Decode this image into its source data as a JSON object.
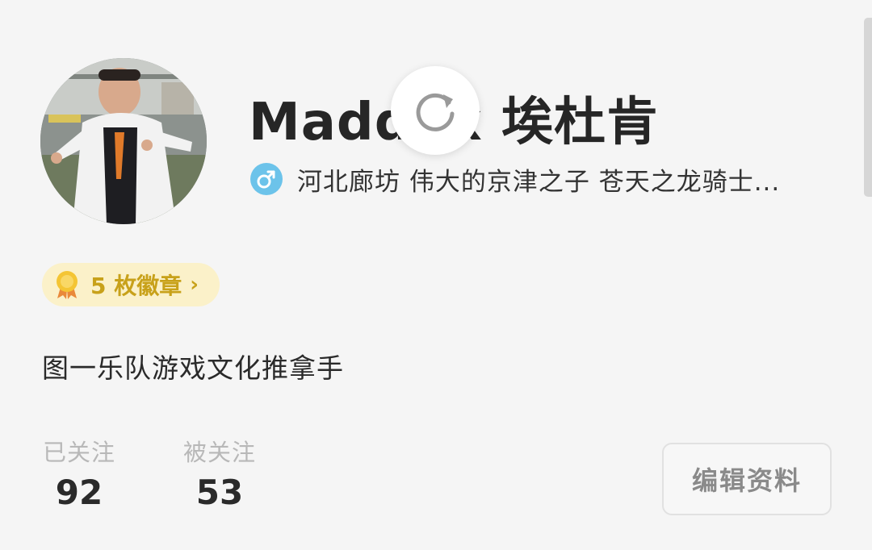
{
  "profile": {
    "username": "Maddox 埃杜肯",
    "gender_icon": "male-symbol-icon",
    "location_bio": "河北廊坊 伟大的京津之子 苍天之龙骑士...",
    "badges_label": "5 枚徽章",
    "badges_chevron": "›",
    "signature": "图一乐队游戏文化推拿手"
  },
  "stats": {
    "following_label": "已关注",
    "following_count": "92",
    "followers_label": "被关注",
    "followers_count": "53"
  },
  "actions": {
    "edit_profile_label": "编辑资料"
  },
  "colors": {
    "background": "#f5f5f5",
    "gender_badge": "#6cc3ea",
    "badge_pill_bg": "#fbf1c9",
    "badge_text": "#c8a11a",
    "muted_label": "#b8b8b8"
  }
}
